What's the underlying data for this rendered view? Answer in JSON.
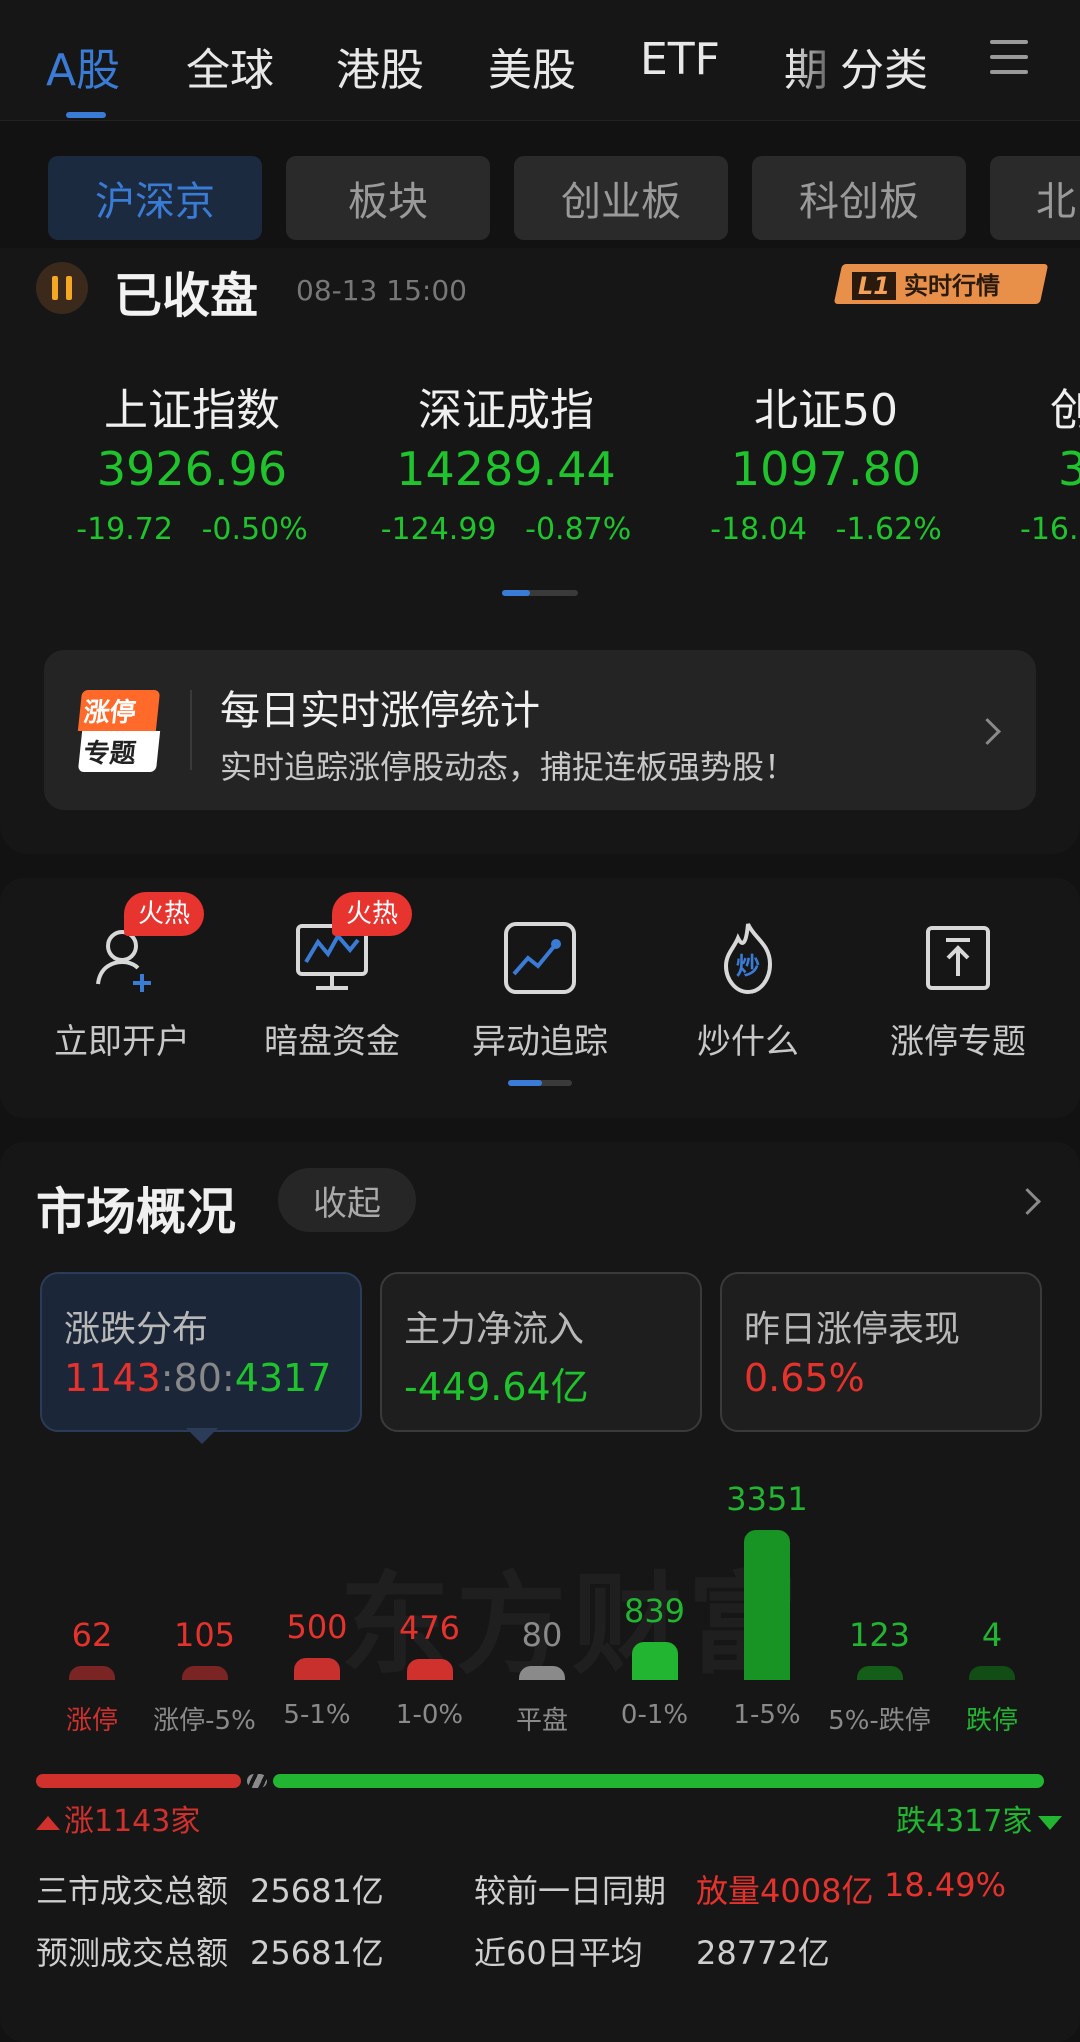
{
  "top_tabs": [
    "A股",
    "全球",
    "港股",
    "美股",
    "ETF",
    "期",
    "分类"
  ],
  "sub_tabs": [
    "沪深京",
    "板块",
    "创业板",
    "科创板",
    "北"
  ],
  "status": {
    "text": "已收盘",
    "time": "08-13  15:00",
    "badge_prefix": "L1",
    "badge_text": "实时行情"
  },
  "indices": [
    {
      "name": "上证指数",
      "value": "3926.96",
      "change": "-19.72",
      "pct": "-0.50%"
    },
    {
      "name": "深证成指",
      "value": "14289.44",
      "change": "-124.99",
      "pct": "-0.87%"
    },
    {
      "name": "北证50",
      "value": "1097.80",
      "change": "-18.04",
      "pct": "-1.62%"
    },
    {
      "name": "创",
      "value": "3",
      "change": "-16.",
      "pct": ""
    }
  ],
  "promo": {
    "badge_top": "涨停",
    "badge_bottom": "专题",
    "title": "每日实时涨停统计",
    "subtitle": "实时追踪涨停股动态，捕捉连板强势股！"
  },
  "tools": [
    {
      "label": "立即开户",
      "badge": "火热",
      "icon": "user-add-icon"
    },
    {
      "label": "暗盘资金",
      "badge": "火热",
      "icon": "monitor-chart-icon"
    },
    {
      "label": "异动追踪",
      "badge": "",
      "icon": "trend-line-icon"
    },
    {
      "label": "炒什么",
      "badge": "",
      "icon": "fire-icon"
    },
    {
      "label": "涨停专题",
      "badge": "",
      "icon": "upload-box-icon"
    }
  ],
  "market": {
    "title": "市场概况",
    "collapse": "收起",
    "cards": [
      {
        "label": "涨跌分布",
        "up": "1143",
        "flat": "80",
        "down": "4317"
      },
      {
        "label": "主力净流入",
        "value": "-449.64亿"
      },
      {
        "label": "昨日涨停表现",
        "value": "0.65%"
      }
    ],
    "watermark": "东方财富"
  },
  "chart_data": {
    "type": "bar",
    "categories": [
      "涨停",
      "涨停-5%",
      "5-1%",
      "1-0%",
      "平盘",
      "0-1%",
      "1-5%",
      "5%-跌停",
      "跌停"
    ],
    "values": [
      62,
      105,
      500,
      476,
      80,
      839,
      3351,
      123,
      4
    ],
    "value_labels": [
      "62",
      "105",
      "500",
      "476",
      "80",
      "839",
      "3351",
      "123",
      "4"
    ],
    "colors": [
      "#7a2424",
      "#7a2424",
      "#c8302e",
      "#d0312d",
      "#8a8a8a",
      "#22b531",
      "#179423",
      "#155e1a",
      "#124d16"
    ],
    "label_colors": [
      "#d0312d",
      "#8a8a8a",
      "#8a8a8a",
      "#8a8a8a",
      "#8a8a8a",
      "#8a8a8a",
      "#8a8a8a",
      "#8a8a8a",
      "#22b531"
    ]
  },
  "ratio": {
    "up_label": "涨1143家",
    "down_label": "跌4317家",
    "up": 1143,
    "flat": 80,
    "down": 4317
  },
  "stats": {
    "total_label": "三市成交总额",
    "total": "25681亿",
    "compare_label": "较前一日同期",
    "compare_tag": "放量4008亿",
    "compare_pct": "18.49%",
    "forecast_label": "预测成交总额",
    "forecast": "25681亿",
    "avg_label": "近60日平均",
    "avg": "28772亿"
  },
  "colors": {
    "accent": "#3a7bd5",
    "up": "#e5322d",
    "down": "#1fc42d",
    "hot": "#e8342f"
  }
}
